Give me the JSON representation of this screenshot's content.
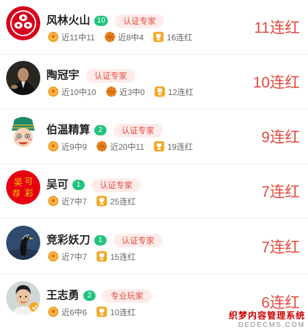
{
  "experts": [
    {
      "name": "风林火山",
      "level": "10",
      "tag": "认证专家",
      "avatar": "clan-crest-avatar",
      "stats": [
        {
          "icon": "soccer-ball-icon",
          "text": "近11中11"
        },
        {
          "icon": "basketball-icon",
          "text": "近8中4"
        },
        {
          "icon": "trophy-cup-icon",
          "text": "16连红"
        }
      ],
      "streak": "11连红"
    },
    {
      "name": "陶冠宇",
      "level": "",
      "tag": "认证专家",
      "avatar": "photo-avatar",
      "stats": [
        {
          "icon": "soccer-ball-icon",
          "text": "近10中10"
        },
        {
          "icon": "basketball-icon",
          "text": "近3中0"
        },
        {
          "icon": "trophy-cup-icon",
          "text": "12连红"
        }
      ],
      "streak": "10连红"
    },
    {
      "name": "伯温精算",
      "level": "2",
      "tag": "认证专家",
      "avatar": "cartoon-avatar",
      "stats": [
        {
          "icon": "soccer-ball-icon",
          "text": "近9中9"
        },
        {
          "icon": "basketball-icon",
          "text": "近20中11"
        },
        {
          "icon": "trophy-cup-icon",
          "text": "19连红"
        }
      ],
      "streak": "9连红"
    },
    {
      "name": "吴可",
      "level": "1",
      "tag": "认证专家",
      "avatar": "calligraphy-avatar",
      "stats": [
        {
          "icon": "soccer-ball-icon",
          "text": "近7中7"
        },
        {
          "icon": "trophy-cup-icon",
          "text": "25连红"
        }
      ],
      "streak": "7连红"
    },
    {
      "name": "竞彩妖刀",
      "level": "1",
      "tag": "认证专家",
      "avatar": "bird-avatar",
      "stats": [
        {
          "icon": "soccer-ball-icon",
          "text": "近7中7"
        },
        {
          "icon": "trophy-cup-icon",
          "text": "15连红"
        }
      ],
      "streak": "7连红"
    },
    {
      "name": "王志勇",
      "level": "2",
      "tag": "专业玩家",
      "avatar": "person-avatar",
      "stats": [
        {
          "icon": "soccer-ball-icon",
          "text": "近6中6"
        },
        {
          "icon": "trophy-cup-icon",
          "text": "10连红"
        }
      ],
      "streak": "6连红"
    }
  ],
  "watermark": {
    "line1": "织梦内容管理系统",
    "line2": "DEDECMS.COM"
  }
}
